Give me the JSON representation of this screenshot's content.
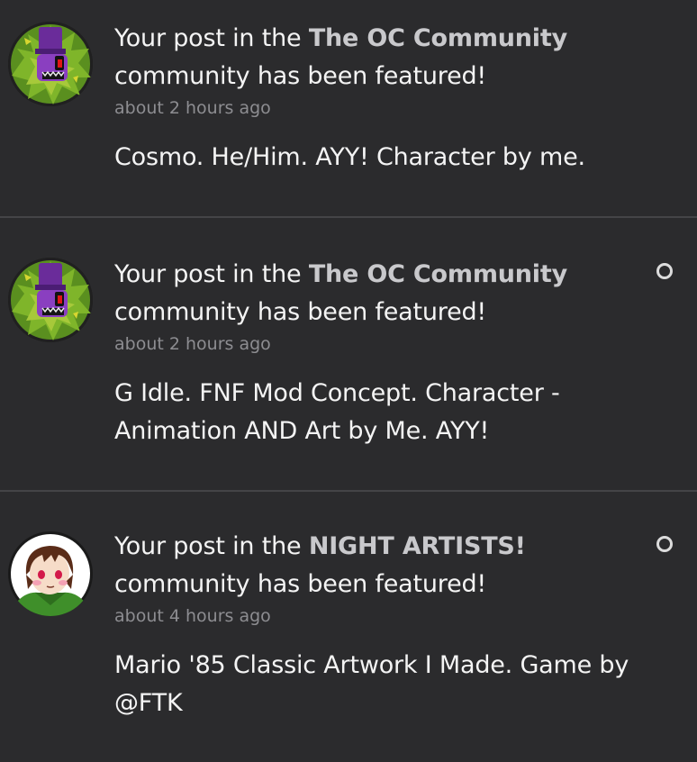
{
  "colors": {
    "background": "#2b2b2d",
    "divider": "#444447",
    "text_primary": "#f4f4f4",
    "community_bold": "#c9c9cc",
    "timestamp": "#8d8d91",
    "unread_indicator": "#dcdcdc"
  },
  "notifications": [
    {
      "avatar_icon": "green-monster-avatar-icon",
      "headline_prefix": "Your post in the ",
      "community": "The OC Community",
      "headline_suffix": "community has been featured!",
      "timestamp": "about 2 hours ago",
      "post_text": "Cosmo. He/Him. AYY! Character by me.",
      "unread": false
    },
    {
      "avatar_icon": "green-monster-avatar-icon",
      "headline_prefix": "Your post in the ",
      "community": "The OC Community",
      "headline_suffix": "community has been featured!",
      "timestamp": "about 2 hours ago",
      "post_text": "G Idle. FNF Mod Concept. Character - Animation AND Art by Me. AYY!",
      "unread": true
    },
    {
      "avatar_icon": "anime-girl-avatar-icon",
      "headline_prefix": "Your post in the ",
      "community": "NIGHT ARTISTS!",
      "headline_suffix": "community has been featured!",
      "timestamp": "about 4 hours ago",
      "post_text": "Mario '85 Classic Artwork I Made. Game by @FTK",
      "unread": true
    }
  ]
}
